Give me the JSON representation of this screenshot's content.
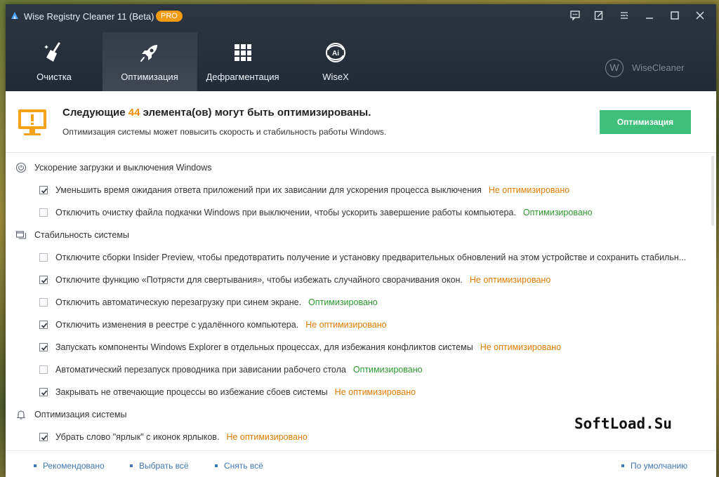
{
  "window": {
    "title": "Wise Registry Cleaner 11 (Beta)",
    "badge": "PRO"
  },
  "nav": {
    "tabs": [
      {
        "label": "Очистка",
        "icon": "broom-icon"
      },
      {
        "label": "Оптимизация",
        "icon": "rocket-icon",
        "active": true
      },
      {
        "label": "Дефрагментация",
        "icon": "grid-blocks-icon"
      },
      {
        "label": "WiseX",
        "icon": "ai-swirl-icon"
      }
    ],
    "brand": "WiseCleaner",
    "brand_logo": "W"
  },
  "summary": {
    "title_prefix": "Следующие ",
    "count": "44",
    "title_suffix": " элемента(ов) могут быть оптимизированы.",
    "description": "Оптимизация системы может повысить скорость и стабильность работы Windows.",
    "button": "Оптимизация"
  },
  "categories": [
    {
      "label": "Ускорение загрузки и выключения Windows",
      "icon": "power-icon",
      "items": [
        {
          "label": "Уменьшить время ожидания ответа приложений при их зависании для ускорения процесса выключения",
          "checked": true,
          "status": "Не оптимизировано"
        },
        {
          "label": "Отключить очистку файла подкачки Windows при выключении, чтобы ускорить завершение работы компьютера.",
          "checked": false,
          "status": "Оптимизировано"
        }
      ]
    },
    {
      "label": "Стабильность системы",
      "icon": "window-stack-icon",
      "items": [
        {
          "label": "Отключите сборки Insider Preview, чтобы предотвратить получение и установку предварительных обновлений на этом устройстве и сохранить стабильн...",
          "checked": false,
          "status": ""
        },
        {
          "label": "Отключите функцию «Потрясти для свертывания», чтобы избежать случайного сворачивания окон.",
          "checked": true,
          "status": "Не оптимизировано"
        },
        {
          "label": "Отключить автоматическую перезагрузку при синем экране.",
          "checked": false,
          "status": "Оптимизировано"
        },
        {
          "label": "Отключить изменения в реестре с удалённого компьютера.",
          "checked": true,
          "status": "Не оптимизировано"
        },
        {
          "label": "Запускать компоненты Windows Explorer в отдельных процессах, для избежания конфликтов системы",
          "checked": true,
          "status": "Не оптимизировано"
        },
        {
          "label": "Автоматический перезапуск проводника при зависании рабочего стола",
          "checked": false,
          "status": "Оптимизировано"
        },
        {
          "label": "Закрывать не отвечающие процессы во избежание сбоев системы",
          "checked": true,
          "status": "Не оптимизировано"
        }
      ]
    },
    {
      "label": "Оптимизация системы",
      "icon": "bell-icon",
      "items": [
        {
          "label": "Убрать слово \"ярлык\" с иконок ярлыков.",
          "checked": true,
          "status": "Не оптимизировано"
        }
      ]
    }
  ],
  "footer": {
    "recommended": "Рекомендовано",
    "select_all": "Выбрать всё",
    "deselect_all": "Снять всё",
    "default": "По умолчанию"
  },
  "watermark": "SoftLoad.Su",
  "colors": {
    "accent_orange": "#f08c00",
    "status_not_optimized": "#e07b00",
    "status_optimized": "#2c9a2c",
    "button_green": "#3ebf7a",
    "link_blue": "#3e78b8",
    "header_dark": "#262e3a"
  }
}
